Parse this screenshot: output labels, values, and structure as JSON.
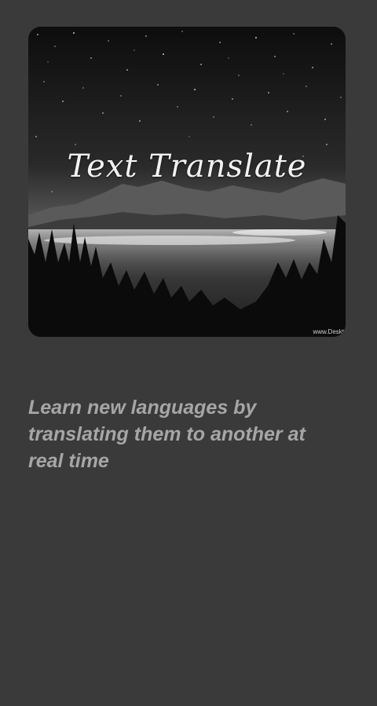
{
  "banner": {
    "title": "Text Translate",
    "watermark": "www.Deskt"
  },
  "tagline": "Learn new languages by translating them to another at real time",
  "colors": {
    "background": "#3a3a3a",
    "tagline_text": "#a6a6a6",
    "banner_title": "#f2f2f2"
  }
}
